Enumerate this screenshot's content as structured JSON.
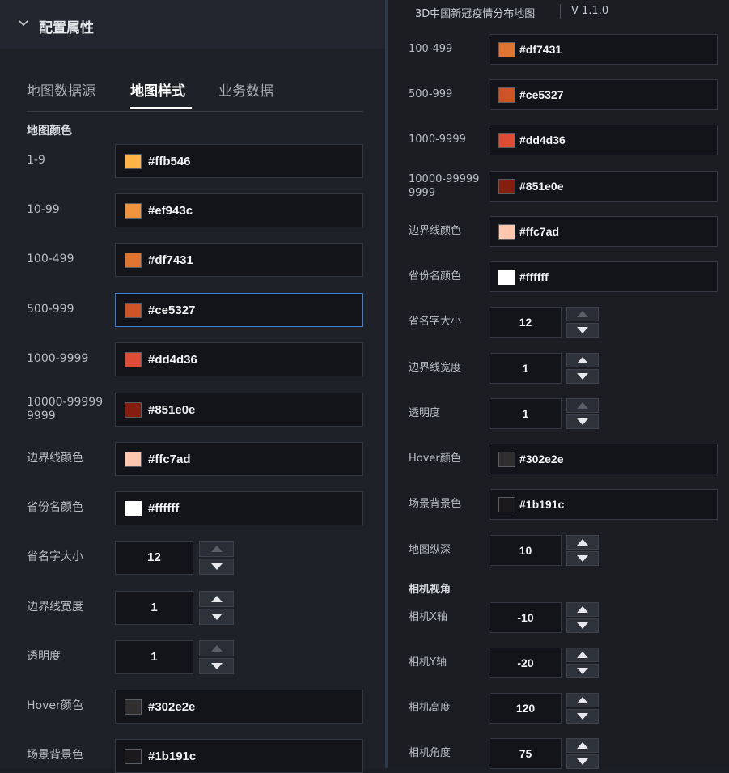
{
  "left_panel": {
    "header_title": "配置属性",
    "tabs": [
      {
        "label": "地图数据源"
      },
      {
        "label": "地图样式"
      },
      {
        "label": "业务数据"
      }
    ],
    "section_title": "地图颜色",
    "color_rows": [
      {
        "label": "1-9",
        "hex": "#ffb546",
        "color": "#ffb546"
      },
      {
        "label": "10-99",
        "hex": "#ef943c",
        "color": "#ef943c"
      },
      {
        "label": "100-499",
        "hex": "#df7431",
        "color": "#df7431"
      },
      {
        "label": "500-999",
        "hex": "#ce5327",
        "color": "#ce5327"
      },
      {
        "label": "1000-9999",
        "hex": "#dd4d36",
        "color": "#dd4d36"
      },
      {
        "label_line1": "10000-99999",
        "label_line2": "9999",
        "hex": "#851e0e",
        "color": "#851e0e"
      },
      {
        "label": "边界线颜色",
        "hex": "#ffc7ad",
        "color": "#ffc7ad"
      },
      {
        "label": "省份名颜色",
        "hex": "#ffffff",
        "color": "#ffffff"
      }
    ],
    "number_rows": [
      {
        "label": "省名字大小",
        "value": "12"
      },
      {
        "label": "边界线宽度",
        "value": "1"
      },
      {
        "label": "透明度",
        "value": "1"
      }
    ],
    "bottom_color_rows": [
      {
        "label": "Hover颜色",
        "hex": "#302e2e",
        "color": "#302e2e"
      },
      {
        "label": "场景背景色",
        "hex": "#1b191c",
        "color": "#1b191c"
      }
    ]
  },
  "right_panel": {
    "app_title": "3D中国新冠疫情分布地图",
    "version": "V 1.1.0",
    "color_rows": [
      {
        "label": "100-499",
        "hex": "#df7431",
        "color": "#df7431"
      },
      {
        "label": "500-999",
        "hex": "#ce5327",
        "color": "#ce5327"
      },
      {
        "label": "1000-9999",
        "hex": "#dd4d36",
        "color": "#dd4d36"
      },
      {
        "label_line1": "10000-99999",
        "label_line2": "9999",
        "hex": "#851e0e",
        "color": "#851e0e"
      },
      {
        "label": "边界线颜色",
        "hex": "#ffc7ad",
        "color": "#ffc7ad"
      },
      {
        "label": "省份名颜色",
        "hex": "#ffffff",
        "color": "#ffffff"
      }
    ],
    "number_rows": [
      {
        "label": "省名字大小",
        "value": "12"
      },
      {
        "label": "边界线宽度",
        "value": "1"
      },
      {
        "label": "透明度",
        "value": "1"
      }
    ],
    "mid_color_rows": [
      {
        "label": "Hover颜色",
        "hex": "#302e2e",
        "color": "#302e2e"
      },
      {
        "label": "场景背景色",
        "hex": "#1b191c",
        "color": "#1b191c"
      }
    ],
    "depth_row": {
      "label": "地图纵深",
      "value": "10"
    },
    "camera_section_title": "相机视角",
    "camera_rows": [
      {
        "label": "相机X轴",
        "value": "-10"
      },
      {
        "label": "相机Y轴",
        "value": "-20"
      },
      {
        "label": "相机高度",
        "value": "120"
      },
      {
        "label": "相机角度",
        "value": "75"
      }
    ]
  },
  "theme": {
    "panel_bg": "#1f2128",
    "field_bg": "#121419",
    "focus_border": "#3d7fd6",
    "text": "#c8ccd3"
  }
}
